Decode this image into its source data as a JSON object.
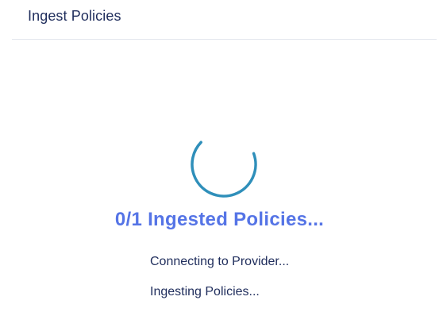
{
  "header": {
    "title": "Ingest Policies"
  },
  "spinner": {
    "icon": "loading-spinner-icon",
    "color": "#2f8fba"
  },
  "progress": {
    "title": "0/1 Ingested Policies..."
  },
  "steps": [
    {
      "label": "Connecting to Provider..."
    },
    {
      "label": "Ingesting Policies..."
    }
  ],
  "colors": {
    "accent": "#5574e6",
    "text": "#1f2d5c",
    "divider": "#e3e6ee"
  }
}
